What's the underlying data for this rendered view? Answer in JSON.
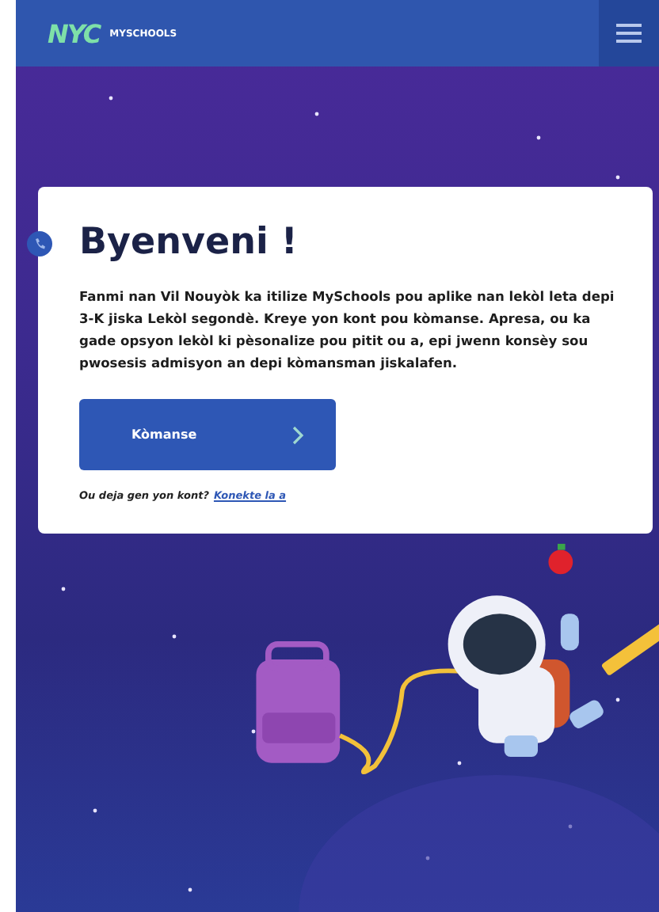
{
  "header": {
    "logo": "NYC",
    "brand": "MYSCHOOLS"
  },
  "welcome": {
    "title": "Byenveni !",
    "body": "Fanmi nan Vil Nouyòk ka itilize MySchools pou aplike nan lekòl leta depi 3-K jiska Lekòl segondè. Kreye yon kont pou kòmanse. Apresa, ou ka gade opsyon lekòl ki pèsonalize pou pitit ou a, epi jwenn konsèy sou pwosesis admisyon an depi kòmansman jiskalafen.",
    "button": "Kòmanse",
    "account_prompt": "Ou deja gen yon kont?",
    "sign_in_link": "Konekte la a"
  }
}
